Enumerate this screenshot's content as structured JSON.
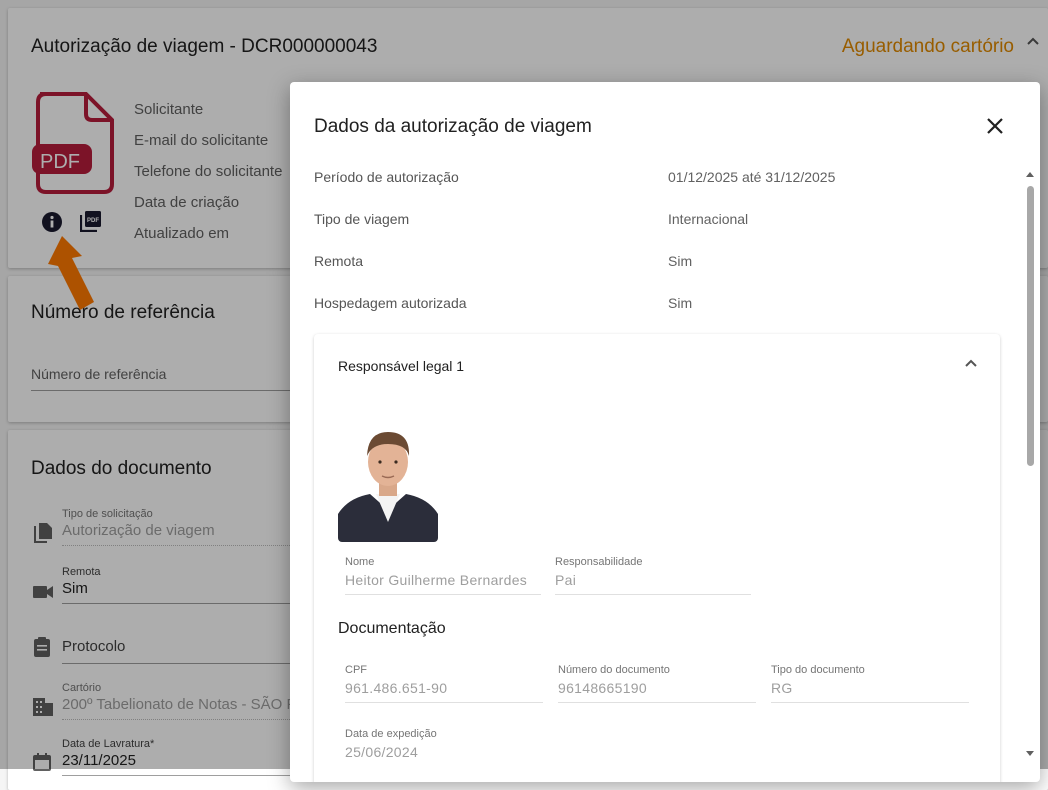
{
  "card1": {
    "title": "Autorização de viagem - DCR000000043",
    "status": "Aguardando cartório",
    "pdf_label": "PDF",
    "meta_labels": [
      "Solicitante",
      "E-mail do solicitante",
      "Telefone do solicitante",
      "Data de criação",
      "Atualizado em"
    ]
  },
  "card2": {
    "title": "Número de referência",
    "field_label": "Número de referência"
  },
  "card3": {
    "title": "Dados do documento",
    "fields": [
      {
        "label": "Tipo de solicitação",
        "value": "Autorização de viagem",
        "icon": "file-copy-icon"
      },
      {
        "label": "Remota",
        "value": "Sim",
        "icon": "videocam-icon"
      },
      {
        "label": "",
        "value": "Protocolo",
        "icon": "clipboard-icon"
      },
      {
        "label": "Cartório",
        "value": "200º Tabelionato de Notas - SÃO P",
        "icon": "building-icon"
      },
      {
        "label": "Data de Lavratura*",
        "value": "23/11/2025",
        "icon": "calendar-icon"
      }
    ]
  },
  "dialog": {
    "title": "Dados da autorização de viagem",
    "rows": [
      {
        "label": "Período de autorização",
        "value": "01/12/2025 até 31/12/2025"
      },
      {
        "label": "Tipo de viagem",
        "value": "Internacional"
      },
      {
        "label": "Remota",
        "value": "Sim"
      },
      {
        "label": "Hospedagem autorizada",
        "value": "Sim"
      }
    ],
    "panel": {
      "title": "Responsável legal 1",
      "nome_label": "Nome",
      "nome_value": "Heitor Guilherme Bernardes",
      "resp_label": "Responsabilidade",
      "resp_value": "Pai",
      "section": "Documentação",
      "cpf_label": "CPF",
      "cpf_value": "961.486.651-90",
      "numdoc_label": "Número do documento",
      "numdoc_value": "96148665190",
      "tipodoc_label": "Tipo do documento",
      "tipodoc_value": "RG",
      "expedicao_label": "Data de expedição",
      "expedicao_value": "25/06/2024"
    }
  },
  "colors": {
    "status": "#e08a00",
    "pdf_red": "#b71c3c",
    "arrow": "#ff7a00"
  }
}
